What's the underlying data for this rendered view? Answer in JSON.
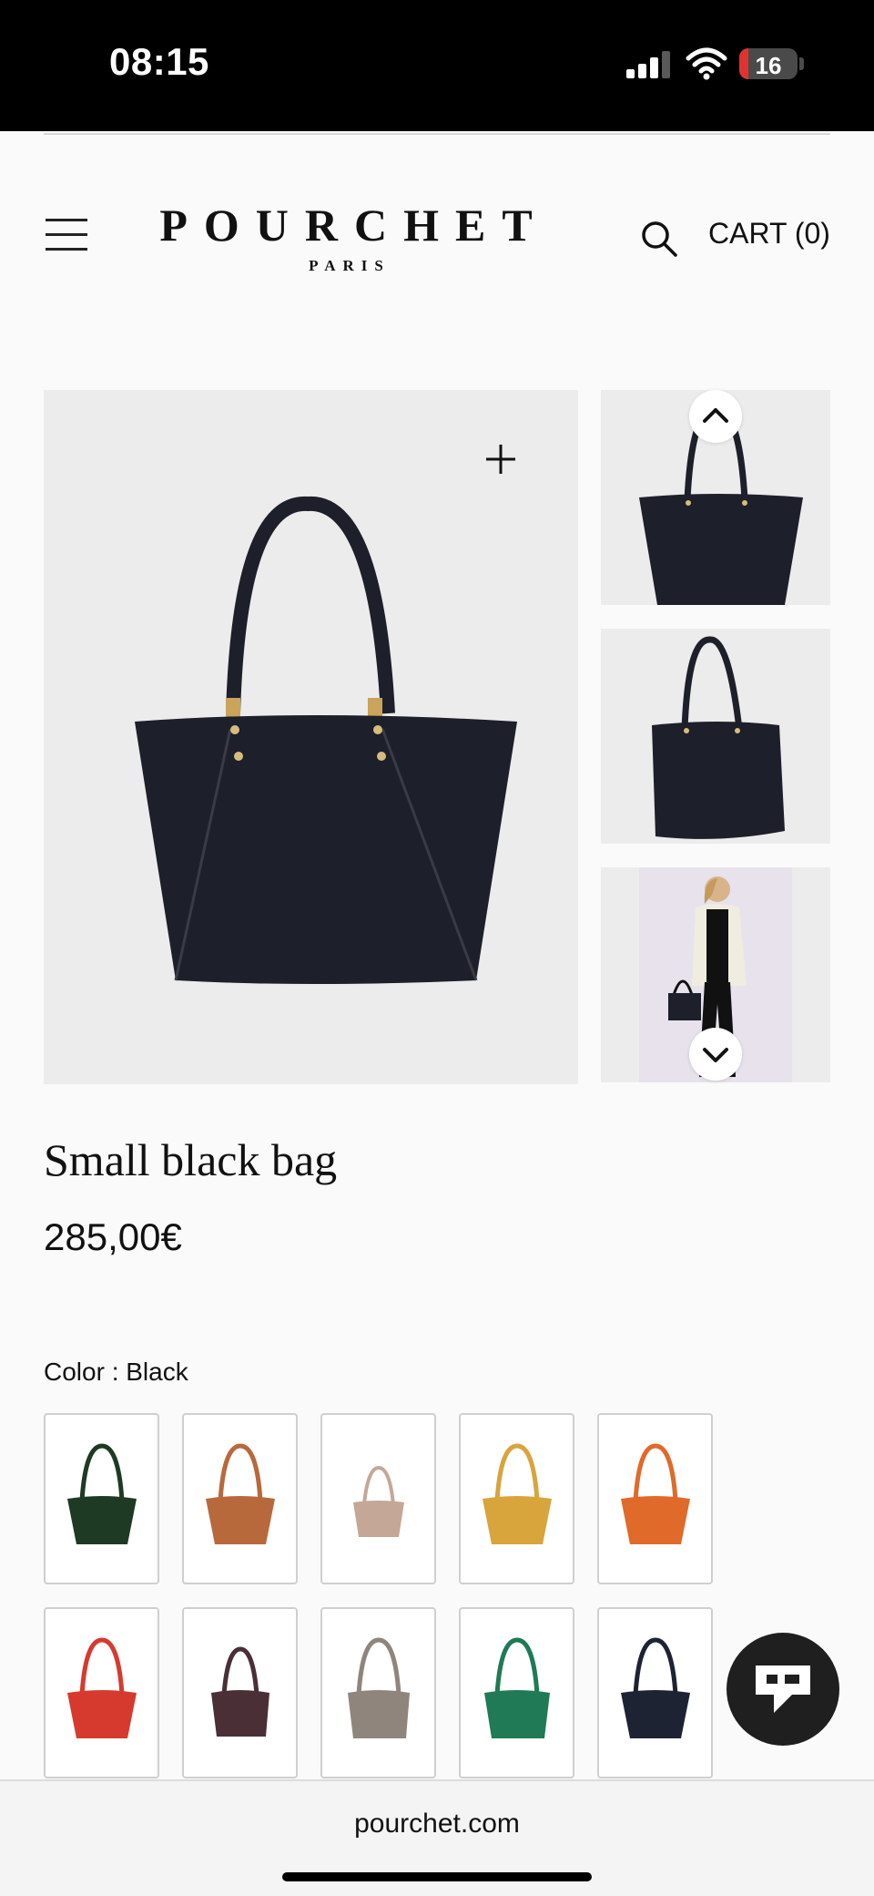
{
  "status_bar": {
    "time": "08:15",
    "battery_level": "16"
  },
  "header": {
    "brand_name": "POURCHET",
    "brand_sub": "PARIS",
    "cart_label": "CART (0)",
    "icons": [
      "menu-icon",
      "search-icon"
    ]
  },
  "gallery": {
    "main_image_alt": "black tote bag",
    "zoom_icon": "plus-icon",
    "nav_icons": [
      "chevron-up-icon",
      "chevron-down-icon"
    ]
  },
  "product": {
    "title": "Small black bag",
    "price": "285,00€",
    "color_label": "Color : Black"
  },
  "colors": {
    "swatches": [
      "#1f3a24",
      "#b8693c",
      "#c4a796",
      "#d8a43c",
      "#e06a2a",
      "#d63a2e",
      "#4a2f36",
      "#8f857c",
      "#1f7a55",
      "#1d2333"
    ]
  },
  "footer": {
    "domain": "pourchet.com"
  }
}
